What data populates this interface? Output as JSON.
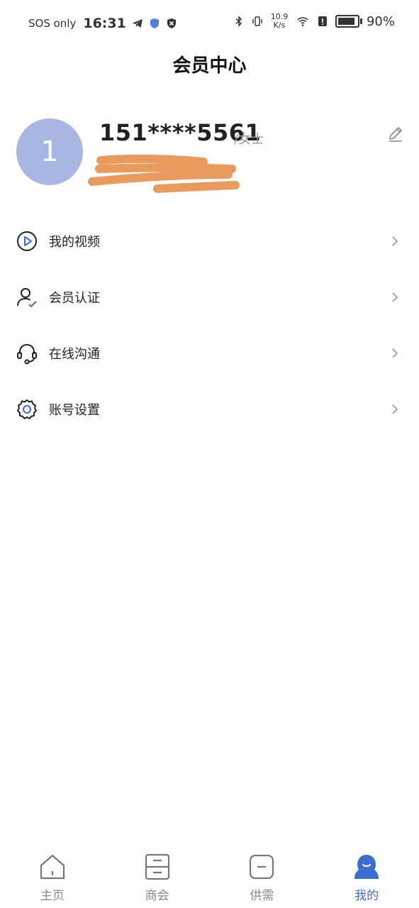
{
  "status_bar": {
    "sos": "SOS only",
    "time": "16:31",
    "net_speed_value": "10.9",
    "net_speed_unit": "K/s",
    "battery": "90%",
    "battery_level": 0.9
  },
  "header": {
    "title": "会员中心"
  },
  "profile": {
    "avatar_text": "1",
    "phone": "151****5561",
    "gender": "/女士",
    "accent_color": "#a7b6e3",
    "redaction_color": "#e99a5e"
  },
  "menu": {
    "items": [
      {
        "label": "我的视频",
        "icon": "play-circle-icon"
      },
      {
        "label": "会员认证",
        "icon": "user-verified-icon"
      },
      {
        "label": "在线沟通",
        "icon": "headset-icon"
      },
      {
        "label": "账号设置",
        "icon": "gear-icon"
      }
    ]
  },
  "bottom_nav": {
    "items": [
      {
        "label": "主页",
        "icon": "home-icon",
        "active": false
      },
      {
        "label": "商会",
        "icon": "cabinet-icon",
        "active": false
      },
      {
        "label": "供需",
        "icon": "box-icon",
        "active": false
      },
      {
        "label": "我的",
        "icon": "profile-icon",
        "active": true
      }
    ],
    "active_color": "#3a6ed1"
  }
}
